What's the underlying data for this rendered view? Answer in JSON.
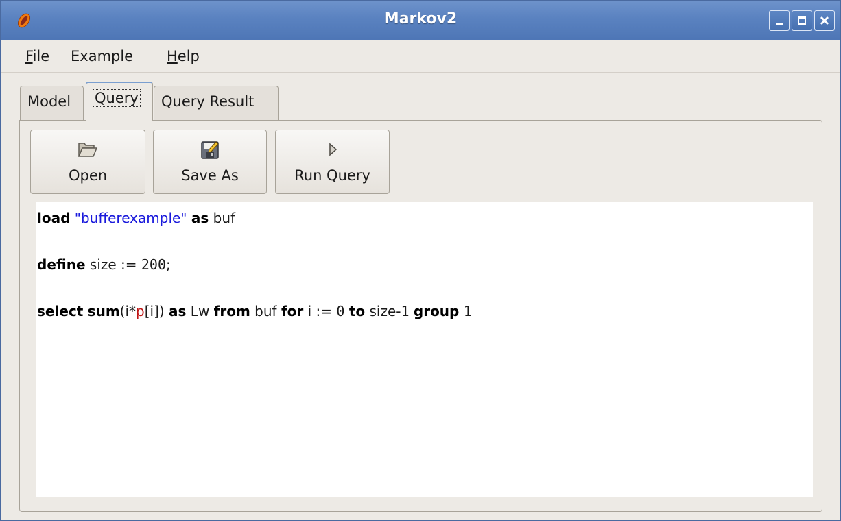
{
  "window": {
    "title": "Markov2",
    "icon": "markov-app-icon",
    "controls": [
      "minimize-icon",
      "maximize-icon",
      "close-icon"
    ]
  },
  "menubar": {
    "items": [
      {
        "label": "File",
        "mnemonic": "F"
      },
      {
        "label": "Example",
        "mnemonic": ""
      },
      {
        "label": "Help",
        "mnemonic": "H"
      }
    ]
  },
  "tabs": [
    {
      "label": "Model",
      "active": false
    },
    {
      "label": "Query",
      "active": true
    },
    {
      "label": "Query Result",
      "active": false
    }
  ],
  "toolbar": {
    "open_label": "Open",
    "open_icon": "folder-open-icon",
    "save_label": "Save As",
    "save_icon": "floppy-save-icon",
    "run_label": "Run Query",
    "run_icon": "play-icon"
  },
  "editor": {
    "lines": [
      [
        {
          "text": "load",
          "kind": "kw"
        },
        {
          "text": " ",
          "kind": "plain"
        },
        {
          "text": "\"bufferexample\"",
          "kind": "str"
        },
        {
          "text": " ",
          "kind": "plain"
        },
        {
          "text": "as",
          "kind": "kw"
        },
        {
          "text": " buf",
          "kind": "plain"
        }
      ],
      [],
      [
        {
          "text": "define",
          "kind": "kw"
        },
        {
          "text": " size := ",
          "kind": "plain"
        },
        {
          "text": "200",
          "kind": "num"
        },
        {
          "text": ";",
          "kind": "plain"
        }
      ],
      [],
      [
        {
          "text": "select",
          "kind": "kw"
        },
        {
          "text": " ",
          "kind": "plain"
        },
        {
          "text": "sum",
          "kind": "kw"
        },
        {
          "text": "(i*",
          "kind": "plain"
        },
        {
          "text": "p",
          "kind": "var"
        },
        {
          "text": "[i]) ",
          "kind": "plain"
        },
        {
          "text": "as",
          "kind": "kw"
        },
        {
          "text": " Lw ",
          "kind": "plain"
        },
        {
          "text": "from",
          "kind": "kw"
        },
        {
          "text": " buf ",
          "kind": "plain"
        },
        {
          "text": "for",
          "kind": "kw"
        },
        {
          "text": " i := ",
          "kind": "plain"
        },
        {
          "text": "0",
          "kind": "num"
        },
        {
          "text": " ",
          "kind": "plain"
        },
        {
          "text": "to",
          "kind": "kw"
        },
        {
          "text": " size-",
          "kind": "plain"
        },
        {
          "text": "1",
          "kind": "num"
        },
        {
          "text": " ",
          "kind": "plain"
        },
        {
          "text": "group",
          "kind": "kw"
        },
        {
          "text": " ",
          "kind": "plain"
        },
        {
          "text": "1",
          "kind": "num"
        }
      ]
    ]
  },
  "colors": {
    "titlebar": "#5a82c0",
    "keyword": "#000000",
    "string": "#1a1adc",
    "variable": "#c01616",
    "window_bg": "#edeae5"
  }
}
